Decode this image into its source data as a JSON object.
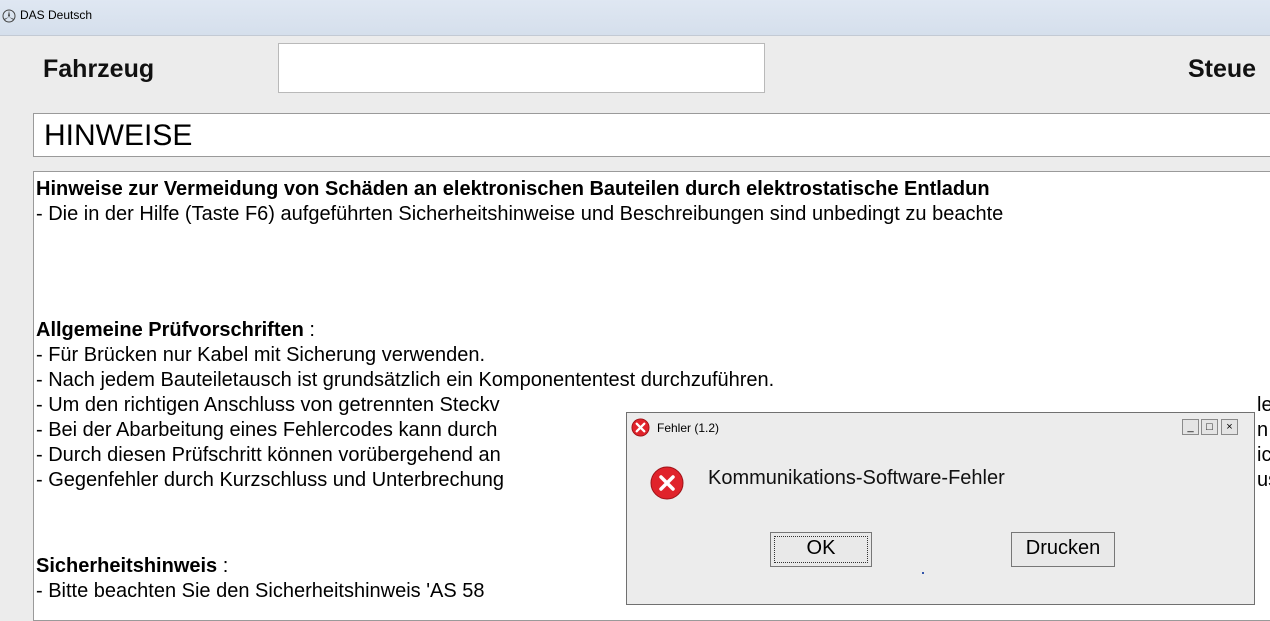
{
  "window": {
    "title": "DAS Deutsch"
  },
  "header": {
    "vehicle_label": "Fahrzeug",
    "vehicle_value": "",
    "steuer_label": "Steue"
  },
  "section": {
    "title": "HINWEISE"
  },
  "content": {
    "lines": [
      "Hinweise zur Vermeidung von Schäden an elektronischen Bauteilen durch elektrostatische Entladun",
      "- Die in der Hilfe (Taste F6) aufgeführten Sicherheitshinweise und Beschreibungen sind unbedingt zu beachte",
      "Allgemeine Prüfvorschriften",
      " :",
      "- Für Brücken nur Kabel mit Sicherung verwenden.",
      "- Nach jedem Bauteiletausch ist grundsätzlich ein Komponententest durchzuführen.",
      "- Um den richtigen Anschluss von getrennten Steckv",
      "- Bei der Abarbeitung eines Fehlercodes kann durch",
      "- Durch diesen Prüfschritt können vorübergehend an",
      "- Gegenfehler durch Kurzschluss und Unterbrechung",
      "Sicherheitshinweis",
      " :",
      "- Bitte beachten Sie den Sicherheitshinweis 'AS 58 ",
      "le",
      "n",
      "ic",
      "us"
    ]
  },
  "dialog": {
    "title": "Fehler",
    "code": "(1.2)",
    "message": "Kommunikations-Software-Fehler",
    "ok_label": "OK",
    "print_label": "Drucken",
    "minimize_label": "_",
    "maximize_label": "□",
    "close_label": "×"
  },
  "colors": {
    "error_red": "#e0232b",
    "title_bar": "#dfe7f2"
  }
}
